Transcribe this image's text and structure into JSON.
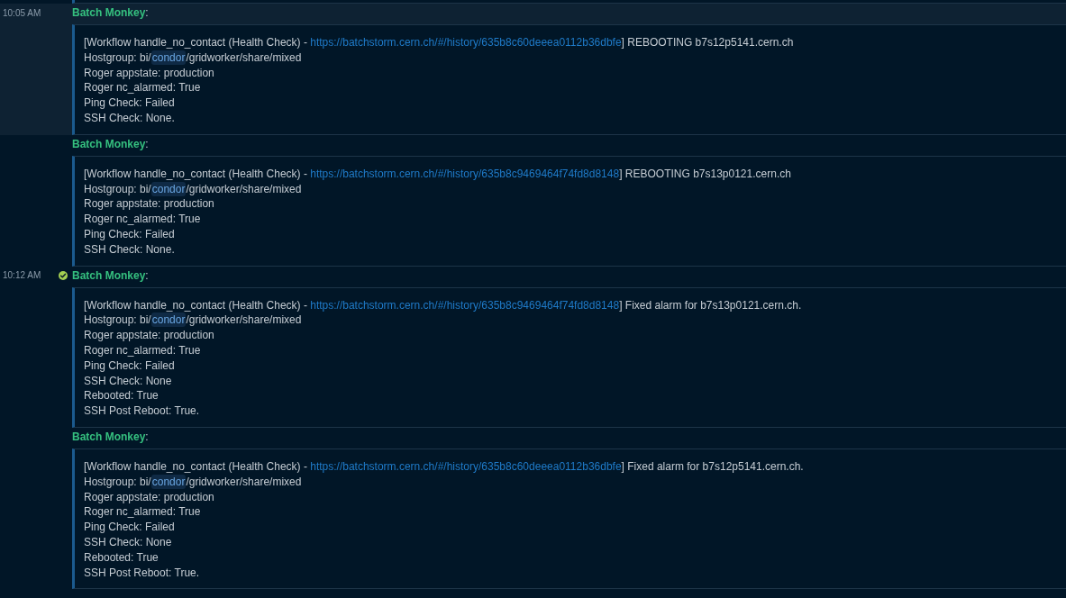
{
  "messages": [
    {
      "time": "10:05 AM",
      "hovered": true,
      "check_mark": false,
      "author": "Batch Monkey",
      "separator": ":",
      "attachment": {
        "summary": {
          "before": "[Workflow handle_no_contact (Health Check) - ",
          "link": "https://batchstorm.cern.ch/#/history/635b8c60deeea0112b36dbfe",
          "after": "] REBOOTING b7s12p5141.cern.ch"
        },
        "hostgroup": {
          "before": "Hostgroup: bi/",
          "highlight": "condor",
          "after": "/gridworker/share/mixed"
        },
        "details": [
          "Roger appstate: production",
          "Roger nc_alarmed: True",
          "Ping Check: Failed",
          "SSH Check: None."
        ]
      }
    },
    {
      "hovered": false,
      "check_mark": false,
      "author": "Batch Monkey",
      "separator": ":",
      "attachment": {
        "summary": {
          "before": "[Workflow handle_no_contact (Health Check) - ",
          "link": "https://batchstorm.cern.ch/#/history/635b8c9469464f74fd8d8148",
          "after": "] REBOOTING b7s13p0121.cern.ch"
        },
        "hostgroup": {
          "before": "Hostgroup: bi/",
          "highlight": "condor",
          "after": "/gridworker/share/mixed"
        },
        "details": [
          "Roger appstate: production",
          "Roger nc_alarmed: True",
          "Ping Check: Failed",
          "SSH Check: None."
        ]
      }
    },
    {
      "time": "10:12 AM",
      "hovered": false,
      "check_mark": true,
      "author": "Batch Monkey",
      "separator": ":",
      "attachment": {
        "summary": {
          "before": "[Workflow handle_no_contact (Health Check) - ",
          "link": "https://batchstorm.cern.ch/#/history/635b8c9469464f74fd8d8148",
          "after": "] Fixed alarm for b7s13p0121.cern.ch."
        },
        "hostgroup": {
          "before": "Hostgroup: bi/",
          "highlight": "condor",
          "after": "/gridworker/share/mixed"
        },
        "details": [
          "Roger appstate: production",
          "Roger nc_alarmed: True",
          "Ping Check: Failed",
          "SSH Check: None",
          "Rebooted: True",
          "SSH Post Reboot: True."
        ]
      }
    },
    {
      "hovered": false,
      "check_mark": false,
      "author": "Batch Monkey",
      "separator": ":",
      "attachment": {
        "summary": {
          "before": "[Workflow handle_no_contact (Health Check) - ",
          "link": "https://batchstorm.cern.ch/#/history/635b8c60deeea0112b36dbfe",
          "after": "] Fixed alarm for b7s12p5141.cern.ch."
        },
        "hostgroup": {
          "before": "Hostgroup: bi/",
          "highlight": "condor",
          "after": "/gridworker/share/mixed"
        },
        "details": [
          "Roger appstate: production",
          "Roger nc_alarmed: True",
          "Ping Check: Failed",
          "SSH Check: None",
          "Rebooted: True",
          "SSH Post Reboot: True."
        ]
      }
    }
  ]
}
